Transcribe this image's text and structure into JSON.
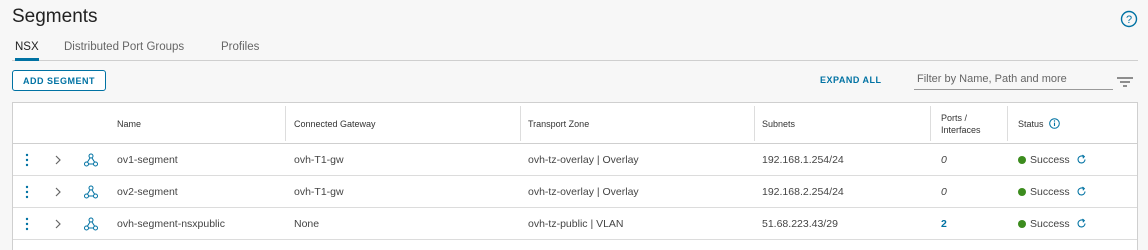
{
  "page": {
    "title": "Segments",
    "help_icon": "help-circle-icon"
  },
  "tabs": [
    {
      "label": "NSX",
      "active": true
    },
    {
      "label": "Distributed Port Groups",
      "active": false
    },
    {
      "label": "Profiles",
      "active": false
    }
  ],
  "toolbar": {
    "add_label": "ADD SEGMENT",
    "expand_label": "EXPAND ALL",
    "filter_placeholder": "Filter by Name, Path and more",
    "filter_value": "",
    "filter_icon": "filter-lines-icon"
  },
  "table": {
    "columns": {
      "name": "Name",
      "gateway": "Connected Gateway",
      "zone": "Transport Zone",
      "subnets": "Subnets",
      "ports_line1": "Ports /",
      "ports_line2": "Interfaces",
      "status": "Status"
    },
    "rows": [
      {
        "name": "ov1-segment",
        "gateway": "ovh-T1-gw",
        "zone": "ovh-tz-overlay | Overlay",
        "subnets": "192.168.1.254/24",
        "ports": "0",
        "status": "Success"
      },
      {
        "name": "ov2-segment",
        "gateway": "ovh-T1-gw",
        "zone": "ovh-tz-overlay | Overlay",
        "subnets": "192.168.2.254/24",
        "ports": "0",
        "status": "Success"
      },
      {
        "name": "ovh-segment-nsxpublic",
        "gateway": "None",
        "zone": "ovh-tz-public | VLAN",
        "subnets": "51.68.223.43/29",
        "ports": "2",
        "status": "Success"
      }
    ]
  },
  "colors": {
    "accent": "#0072a3",
    "success": "#3c8c1e"
  }
}
